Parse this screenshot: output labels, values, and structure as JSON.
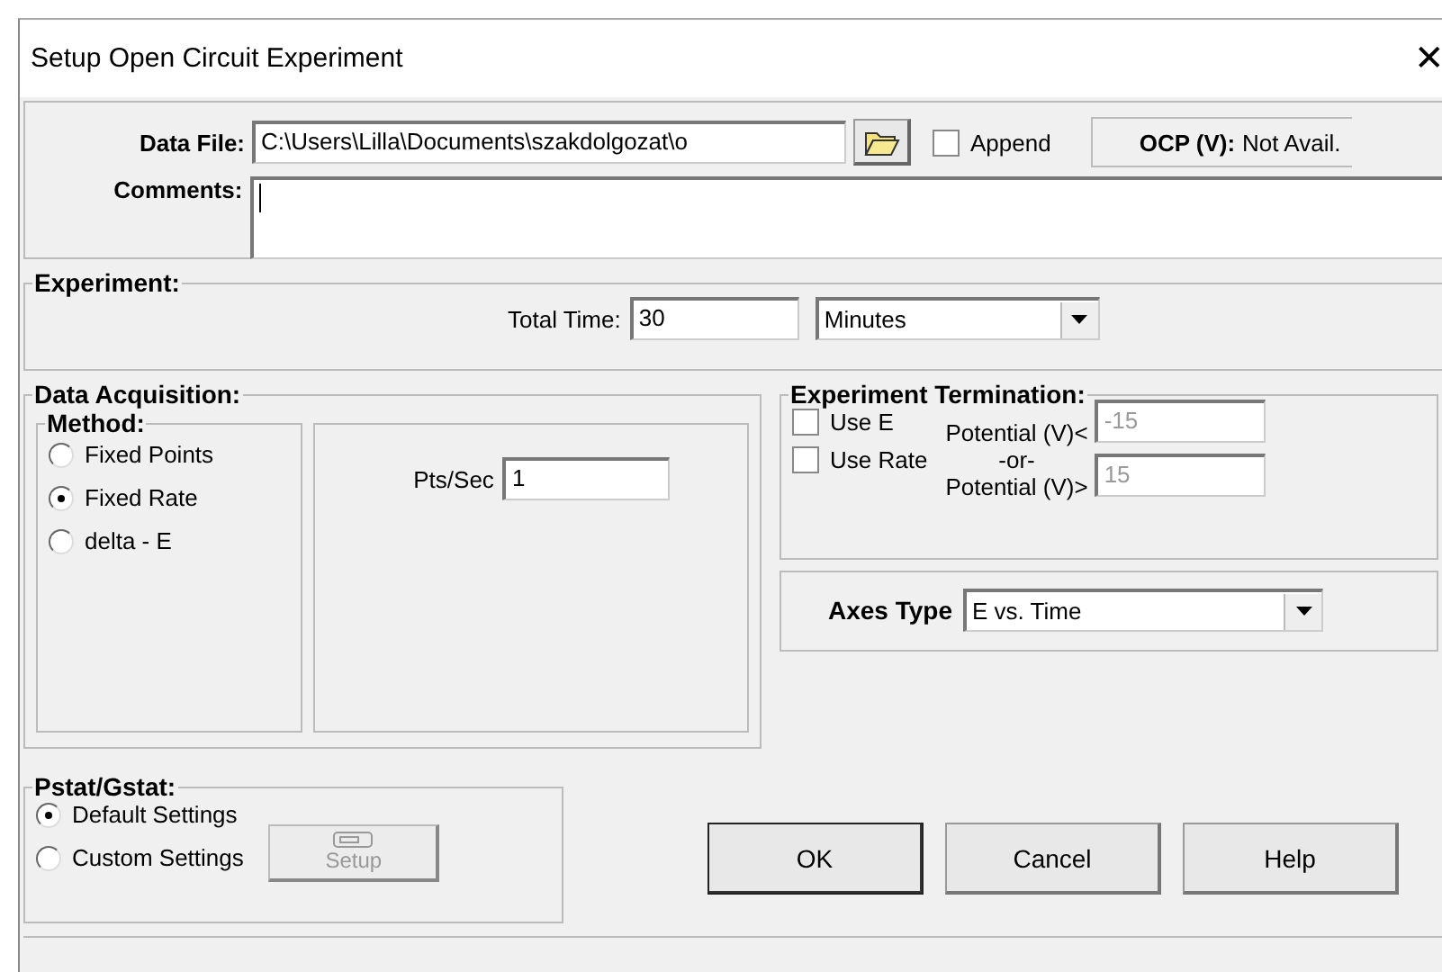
{
  "window": {
    "title": "Setup Open Circuit Experiment",
    "close": "✕"
  },
  "data_file": {
    "label": "Data File:",
    "value": "C:\\Users\\Lilla\\Documents\\szakdolgozat\\o"
  },
  "append": {
    "label": "Append",
    "checked": false
  },
  "ocp": {
    "label": "OCP (V):",
    "value": "Not Avail."
  },
  "comments": {
    "label": "Comments:"
  },
  "experiment": {
    "title": "Experiment:",
    "total_time_label": "Total Time:",
    "total_time": "30",
    "unit": "Minutes"
  },
  "data_acquisition": {
    "title": "Data Acquisition:",
    "method_title": "Method:",
    "methods": [
      {
        "label": "Fixed Points",
        "selected": false
      },
      {
        "label": "Fixed Rate",
        "selected": true
      },
      {
        "label": "delta - E",
        "selected": false
      }
    ],
    "rate_label": "Pts/Sec",
    "rate": "1"
  },
  "termination": {
    "title": "Experiment Termination:",
    "options": [
      {
        "label": "Use E",
        "checked": false
      },
      {
        "label": "Use Rate",
        "checked": false
      }
    ],
    "lower_label": "Potential (V)<",
    "lower": "-15",
    "or": "-or-",
    "upper_label": "Potential (V)>",
    "upper": "15",
    "limits_disabled": true
  },
  "axes": {
    "label": "Axes Type",
    "value": "E vs. Time"
  },
  "pstat": {
    "title": "Pstat/Gstat:",
    "options": [
      {
        "label": "Default Settings",
        "selected": true
      },
      {
        "label": "Custom Settings",
        "selected": false
      }
    ],
    "setup": {
      "label": "Setup",
      "disabled": true
    }
  },
  "buttons": [
    {
      "label": "OK",
      "default": true
    },
    {
      "label": "Cancel",
      "default": false
    },
    {
      "label": "Help",
      "default": false
    }
  ]
}
